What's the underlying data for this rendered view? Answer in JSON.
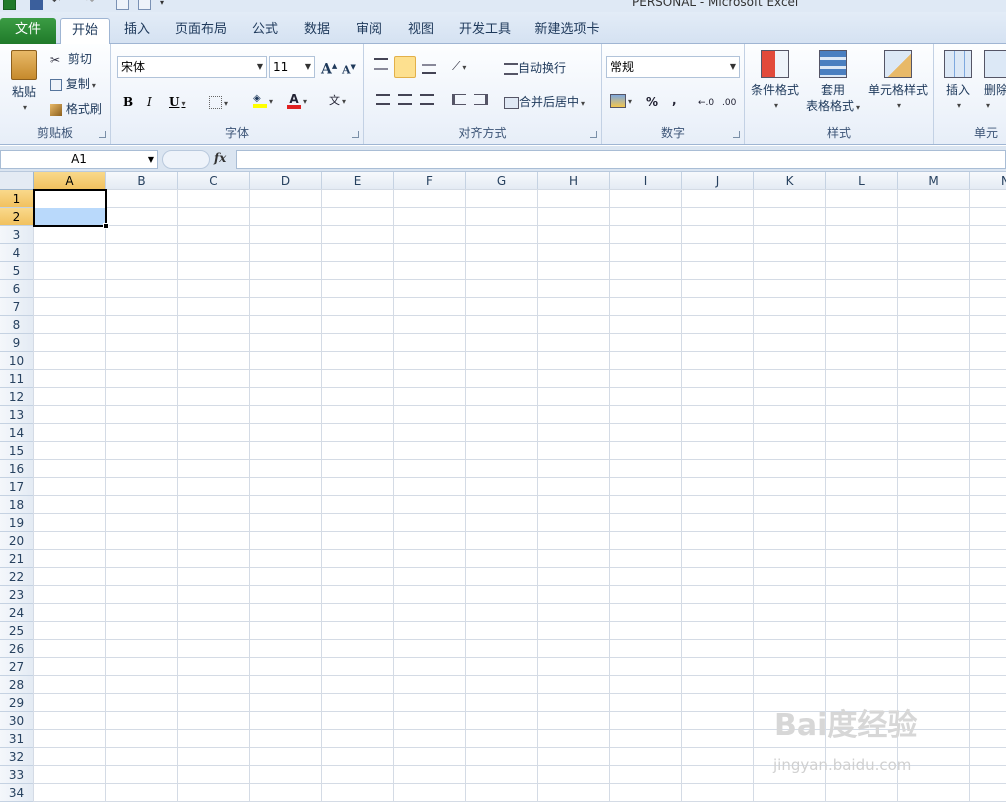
{
  "window": {
    "title": "PERSONAL - Microsoft Excel"
  },
  "tabs": [
    {
      "label": "文件"
    },
    {
      "label": "开始"
    },
    {
      "label": "插入"
    },
    {
      "label": "页面布局"
    },
    {
      "label": "公式"
    },
    {
      "label": "数据"
    },
    {
      "label": "审阅"
    },
    {
      "label": "视图"
    },
    {
      "label": "开发工具"
    },
    {
      "label": "新建选项卡"
    }
  ],
  "clipboard": {
    "paste": "粘贴",
    "cut": "剪切",
    "copy": "复制",
    "format_painter": "格式刷",
    "group": "剪贴板"
  },
  "font": {
    "name": "宋体",
    "size": "11",
    "bold": "B",
    "italic": "I",
    "underline": "U",
    "grow": "A",
    "shrink": "A",
    "group": "字体"
  },
  "alignment": {
    "wrap": "自动换行",
    "merge": "合并后居中",
    "group": "对齐方式"
  },
  "number": {
    "format": "常规",
    "percent": "%",
    "comma": ",",
    "group": "数字"
  },
  "styles": {
    "conditional": "条件格式",
    "table_line1": "套用",
    "table_line2": "表格格式",
    "cell_styles": "单元格样式",
    "group": "样式"
  },
  "cells": {
    "insert": "插入",
    "delete": "删除",
    "group": "单元"
  },
  "formula_bar": {
    "name_box": "A1",
    "fx": "fx",
    "formula": ""
  },
  "sheet": {
    "columns": [
      "A",
      "B",
      "C",
      "D",
      "E",
      "F",
      "G",
      "H",
      "I",
      "J",
      "K",
      "L",
      "M",
      "N"
    ],
    "rows": [
      "1",
      "2",
      "3",
      "4",
      "5",
      "6",
      "7",
      "8",
      "9",
      "10",
      "11",
      "12",
      "13",
      "14",
      "15",
      "16",
      "17",
      "18",
      "19",
      "20",
      "21",
      "22",
      "23",
      "24",
      "25",
      "26",
      "27",
      "28",
      "29",
      "30",
      "31",
      "32",
      "33",
      "34"
    ],
    "selected_range": "A1:A2",
    "active_cell": "A1"
  },
  "watermark": {
    "brand": "Bai度经验",
    "url": "jingyan.baidu.com"
  },
  "colors": {
    "file_tab": "#2a8a35",
    "selected_header": "#f5cd72",
    "selection_fill": "#b9d9fb"
  }
}
